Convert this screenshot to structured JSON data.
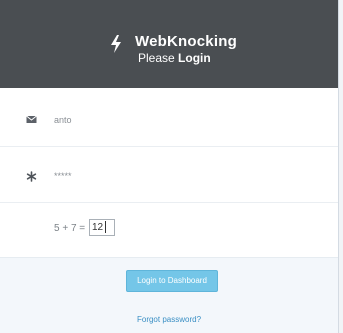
{
  "header": {
    "title": "WebKnocking",
    "subtitle_prefix": "Please",
    "subtitle_strong": "Login",
    "background": "#4a4e52"
  },
  "form": {
    "username": {
      "icon": "envelope-icon",
      "value": "anto"
    },
    "password": {
      "icon": "asterisk-icon",
      "value": "*****"
    },
    "captcha": {
      "question": "5 + 7 =",
      "answer": "12"
    }
  },
  "actions": {
    "login_label": "Login to Dashboard",
    "login_color": "#74c6e8",
    "forgot_label": "Forgot password?",
    "link_color": "#3a8fc4"
  }
}
